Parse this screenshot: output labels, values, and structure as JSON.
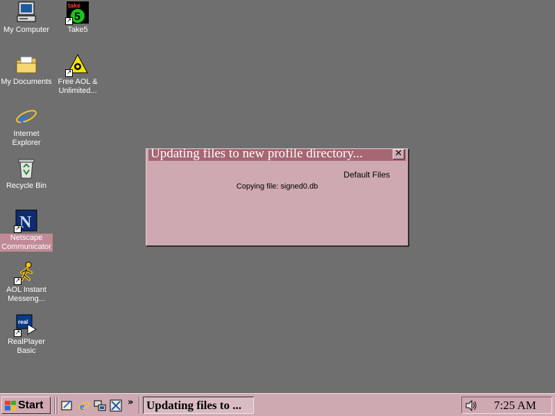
{
  "desktop": {
    "icons": [
      {
        "label": "My Computer",
        "icon": "computer-icon"
      },
      {
        "label": "Take5",
        "icon": "take5-icon",
        "shortcut": true
      },
      {
        "label": "My Documents",
        "icon": "folder-icon"
      },
      {
        "label": "Free AOL & Unlimited...",
        "icon": "aol-triangle-icon",
        "shortcut": true
      },
      {
        "label": "Internet Explorer",
        "icon": "internet-explorer-icon"
      },
      {
        "label": "Recycle Bin",
        "icon": "recycle-bin-icon"
      },
      {
        "label": "Netscape Communicator",
        "icon": "netscape-icon",
        "shortcut": true,
        "selected": true
      },
      {
        "label": "AOL Instant Messeng...",
        "icon": "aim-running-man-icon",
        "shortcut": true
      },
      {
        "label": "RealPlayer Basic",
        "icon": "realplayer-icon",
        "shortcut": true
      }
    ]
  },
  "dialog": {
    "title": "Updating files to new profile directory...",
    "close_label": "✕",
    "section_label": "Default Files",
    "status_text": "Copying file: signed0.db"
  },
  "taskbar": {
    "start_label": "Start",
    "chevron": "»",
    "task_button_label": "Updating files to ...",
    "clock": "7:25 AM"
  },
  "colors": {
    "desktop": "#6f6f6f",
    "window_face": "#cfa9b2",
    "title_bar": "#a76674",
    "selection": "#c08a96"
  }
}
